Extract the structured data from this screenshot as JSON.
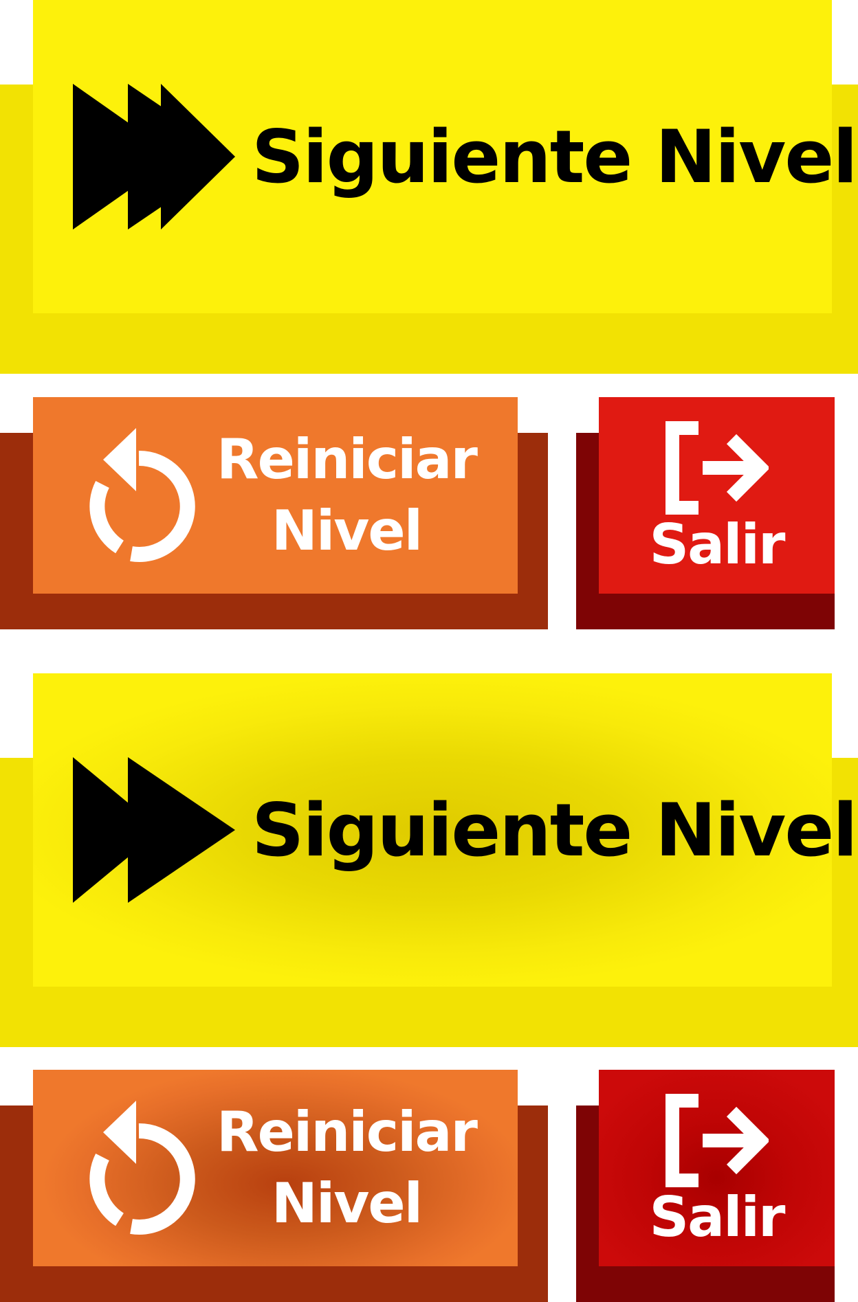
{
  "colors": {
    "yellow_face": "#fdf10b",
    "yellow_shadow": "#f2e203",
    "orange_face": "#ef782c",
    "orange_shadow": "#9c2d0b",
    "red_face": "#e01a12",
    "red_shadow": "#7e0405"
  },
  "buttons_normal": {
    "next_level_label": "Siguiente Nivel",
    "next_level_icon": "fast-forward-icon",
    "restart_label_line1": "Reiniciar",
    "restart_label_line2": "Nivel",
    "restart_icon": "restart-icon",
    "exit_label": "Salir",
    "exit_icon": "exit-icon"
  },
  "buttons_pressed": {
    "next_level_label": "Siguiente Nivel",
    "next_level_icon": "fast-forward-icon",
    "restart_label_line1": "Reiniciar",
    "restart_label_line2": "Nivel",
    "restart_icon": "restart-icon",
    "exit_label": "Salir",
    "exit_icon": "exit-icon"
  }
}
